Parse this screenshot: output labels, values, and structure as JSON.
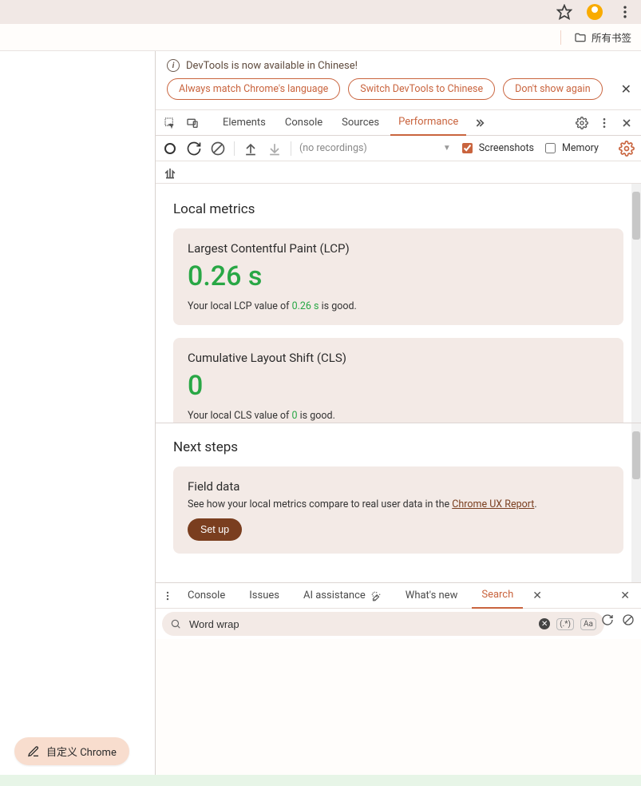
{
  "browser": {
    "all_bookmarks": "所有书签"
  },
  "infobar": {
    "message": "DevTools is now available in Chinese!",
    "pills": {
      "match": "Always match Chrome's language",
      "switch": "Switch DevTools to Chinese",
      "dont": "Don't show again"
    }
  },
  "tabs": {
    "elements": "Elements",
    "console": "Console",
    "sources": "Sources",
    "performance": "Performance"
  },
  "perfbar": {
    "no_recordings": "(no recordings)",
    "screenshots": "Screenshots",
    "memory": "Memory"
  },
  "metrics": {
    "section_title": "Local metrics",
    "lcp": {
      "title": "Largest Contentful Paint (LCP)",
      "value": "0.26 s",
      "sub_pre": "Your local LCP value of ",
      "sub_val": "0.26 s",
      "sub_post": " is good."
    },
    "cls": {
      "title": "Cumulative Layout Shift (CLS)",
      "value": "0",
      "sub_pre": "Your local CLS value of ",
      "sub_val": "0",
      "sub_post": " is good."
    }
  },
  "next": {
    "title": "Next steps",
    "field_title": "Field data",
    "field_text_pre": "See how your local metrics compare to real user data in the ",
    "field_link": "Chrome UX Report",
    "field_text_post": ".",
    "setup": "Set up"
  },
  "drawer": {
    "tabs": {
      "console": "Console",
      "issues": "Issues",
      "ai": "AI assistance",
      "whatsnew": "What's new",
      "search": "Search"
    },
    "search_value": "Word wrap",
    "regex_chip": "(.*)",
    "case_chip": "Aa"
  },
  "customize": "自定义 Chrome"
}
